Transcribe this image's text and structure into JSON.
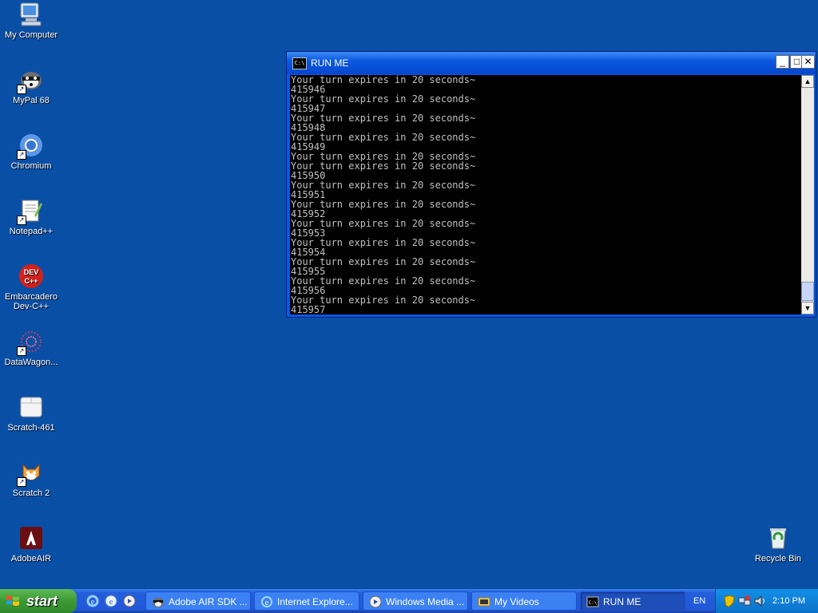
{
  "desktop": {
    "icons": [
      {
        "label": "My Computer"
      },
      {
        "label": "MyPal 68"
      },
      {
        "label": "Chromium"
      },
      {
        "label": "Notepad++"
      },
      {
        "label": "Embarcadero Dev-C++",
        "line1": "Embarcadero",
        "line2": "Dev-C++"
      },
      {
        "label": "DataWagon..."
      },
      {
        "label": "Scratch-461"
      },
      {
        "label": "Scratch 2"
      },
      {
        "label": "AdobeAIR"
      },
      {
        "label": "Recycle Bin"
      }
    ]
  },
  "window": {
    "title": "RUN ME",
    "icon_text": "C:\\",
    "minimize": "_",
    "maximize": "□",
    "close": "✕",
    "console_lines": [
      "Your turn expires in 20 seconds~",
      "415946",
      "Your turn expires in 20 seconds~",
      "415947",
      "Your turn expires in 20 seconds~",
      "415948",
      "Your turn expires in 20 seconds~",
      "415949",
      "Your turn expires in 20 seconds~",
      "Your turn expires in 20 seconds~",
      "415950",
      "Your turn expires in 20 seconds~",
      "415951",
      "Your turn expires in 20 seconds~",
      "415952",
      "Your turn expires in 20 seconds~",
      "415953",
      "Your turn expires in 20 seconds~",
      "415954",
      "Your turn expires in 20 seconds~",
      "415955",
      "Your turn expires in 20 seconds~",
      "415956",
      "Your turn expires in 20 seconds~",
      "415957"
    ],
    "scroll_up": "▲",
    "scroll_down": "▼"
  },
  "taskbar": {
    "start_label": "start",
    "tasks": [
      {
        "label": "Adobe AIR SDK ..."
      },
      {
        "label": "Internet Explore..."
      },
      {
        "label": "Windows Media ..."
      },
      {
        "label": "My Videos"
      },
      {
        "label": "RUN ME"
      }
    ],
    "language": "EN",
    "clock": "2:10 PM"
  },
  "colors": {
    "desktop_bg": "#0a4fa6",
    "taskbar": "#245edb",
    "start_green": "#3c9a35",
    "console_bg": "#000000",
    "console_text": "#c0c0c0"
  }
}
